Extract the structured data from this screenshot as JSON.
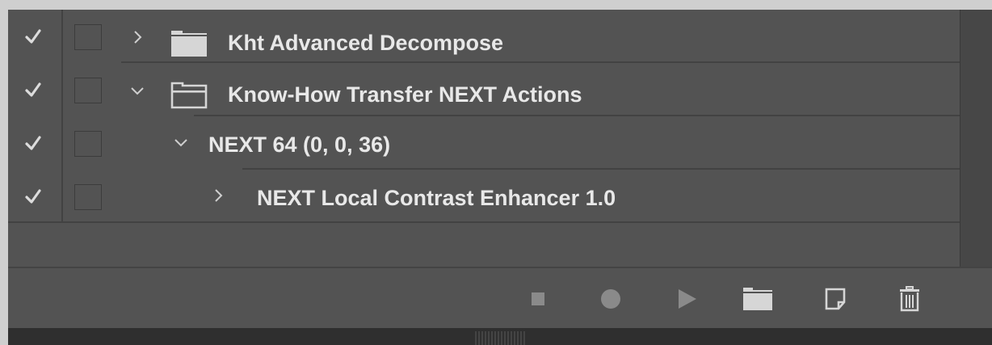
{
  "actions": {
    "rows": [
      {
        "label": "Kht Advanced Decompose",
        "checked": true,
        "expanded": false,
        "type": "set",
        "icon": "folder-filled-icon"
      },
      {
        "label": "Know-How Transfer NEXT Actions",
        "checked": true,
        "expanded": true,
        "type": "set",
        "icon": "folder-open-icon"
      },
      {
        "label": "NEXT 64 (0, 0, 36)",
        "checked": true,
        "expanded": true,
        "type": "action"
      },
      {
        "label": "NEXT Local Contrast Enhancer 1.0",
        "checked": true,
        "expanded": false,
        "type": "step"
      }
    ]
  },
  "toolbar": {
    "buttons": [
      {
        "name": "stop-playing-recording",
        "icon": "stop-icon"
      },
      {
        "name": "begin-recording",
        "icon": "record-icon"
      },
      {
        "name": "play-selection",
        "icon": "play-icon"
      },
      {
        "name": "create-new-set",
        "icon": "folder-icon"
      },
      {
        "name": "create-new-action",
        "icon": "new-item-icon"
      },
      {
        "name": "delete",
        "icon": "trash-icon"
      }
    ]
  },
  "colors": {
    "panel_bg": "#535353",
    "text": "#e8e8e8",
    "icon": "#d6d6d6",
    "disabled_icon": "#8a8a8a",
    "separator": "#424242"
  }
}
